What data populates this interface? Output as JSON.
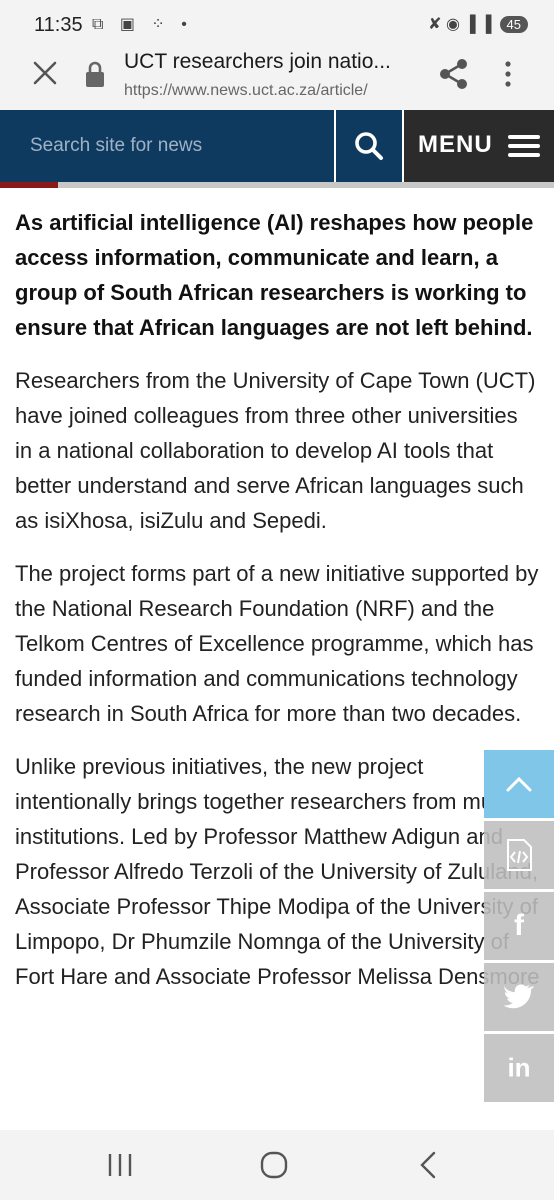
{
  "status_bar": {
    "time": "11:35",
    "left_icons": "⧉ ▣ ⁘ •",
    "right_icons": "✘ ◉ ▐ ▐",
    "battery": "45"
  },
  "browser": {
    "page_title": "UCT researchers join natio...",
    "url": "https://www.news.uct.ac.za/article/"
  },
  "site_header": {
    "search_placeholder": "Search site for news",
    "menu_label": "MENU"
  },
  "article": {
    "lead": "As artificial intelligence (AI) reshapes how people access information, communicate and learn, a group of South African researchers is working to ensure that African languages are not left behind.",
    "paragraphs": [
      "Researchers from the University of Cape Town (UCT) have joined colleagues from three other universities in a national collaboration to develop AI tools that better understand and serve African languages such as isiXhosa, isiZulu and Sepedi.",
      "The project forms part of a new initiative supported by the National Research Foundation (NRF) and the Telkom Centres of Excellence programme, which has funded information and communications technology research in South Africa for more than two decades.",
      "Unlike previous initiatives, the new project intentionally brings together researchers from multiple institutions. Led by Professor Matthew Adigun and Professor Alfredo Terzoli of the University of Zululand, Associate Professor Thipe Modipa of the University of Limpopo, Dr Phumzile Nomnga of the University of Fort Hare and Associate Professor Melissa Densmore"
    ]
  },
  "social": {
    "facebook_glyph": "f",
    "linkedin_glyph": "in"
  },
  "colors": {
    "header_blue": "#0f3a5f",
    "menu_dark": "#2b2b2b",
    "accent_red": "#8a1a1a",
    "scroll_up_blue": "#7fc6e8"
  },
  "icons": [
    "close-icon",
    "lock-icon",
    "share-icon",
    "more-vert-icon",
    "search-icon",
    "hamburger-icon",
    "chevron-up-icon",
    "code-file-icon",
    "facebook-icon",
    "twitter-icon",
    "linkedin-icon",
    "recent-apps-icon",
    "home-icon",
    "back-icon"
  ]
}
